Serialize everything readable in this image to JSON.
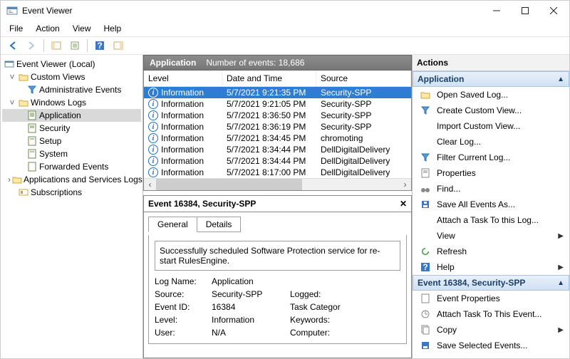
{
  "title": "Event Viewer",
  "menu": [
    "File",
    "Action",
    "View",
    "Help"
  ],
  "tree": {
    "root": "Event Viewer (Local)",
    "custom": "Custom Views",
    "admin": "Administrative Events",
    "winlogs": "Windows Logs",
    "app": "Application",
    "sec": "Security",
    "setup": "Setup",
    "sys": "System",
    "fwd": "Forwarded Events",
    "apps_svc": "Applications and Services Logs",
    "subs": "Subscriptions"
  },
  "grid": {
    "header": "Application",
    "count_label": "Number of events: 18,686",
    "col_level": "Level",
    "col_date": "Date and Time",
    "col_source": "Source",
    "rows": [
      {
        "level": "Information",
        "dt": "5/7/2021 9:21:35 PM",
        "src": "Security-SPP"
      },
      {
        "level": "Information",
        "dt": "5/7/2021 9:21:05 PM",
        "src": "Security-SPP"
      },
      {
        "level": "Information",
        "dt": "5/7/2021 8:36:50 PM",
        "src": "Security-SPP"
      },
      {
        "level": "Information",
        "dt": "5/7/2021 8:36:19 PM",
        "src": "Security-SPP"
      },
      {
        "level": "Information",
        "dt": "5/7/2021 8:34:45 PM",
        "src": "chromoting"
      },
      {
        "level": "Information",
        "dt": "5/7/2021 8:34:44 PM",
        "src": "DellDigitalDelivery"
      },
      {
        "level": "Information",
        "dt": "5/7/2021 8:34:44 PM",
        "src": "DellDigitalDelivery"
      },
      {
        "level": "Information",
        "dt": "5/7/2021 8:17:00 PM",
        "src": "DellDigitalDelivery"
      }
    ]
  },
  "detail": {
    "title": "Event 16384, Security-SPP",
    "tab_general": "General",
    "tab_details": "Details",
    "message": "Successfully scheduled Software Protection service for re-start RulesEngine.",
    "lbl_logname": "Log Name:",
    "val_logname": "Application",
    "lbl_source": "Source:",
    "val_source": "Security-SPP",
    "lbl_eventid": "Event ID:",
    "val_eventid": "16384",
    "lbl_level": "Level:",
    "val_level": "Information",
    "lbl_user": "User:",
    "val_user": "N/A",
    "lbl_logged": "Logged:",
    "lbl_taskcat": "Task Categor",
    "lbl_keywords": "Keywords:",
    "lbl_computer": "Computer:"
  },
  "actions": {
    "header": "Actions",
    "sec_app": "Application",
    "sec_evt": "Event 16384, Security-SPP",
    "open_saved": "Open Saved Log...",
    "create_custom": "Create Custom View...",
    "import_custom": "Import Custom View...",
    "clear_log": "Clear Log...",
    "filter_log": "Filter Current Log...",
    "properties": "Properties",
    "find": "Find...",
    "save_all": "Save All Events As...",
    "attach_log": "Attach a Task To this Log...",
    "view": "View",
    "refresh": "Refresh",
    "help": "Help",
    "evt_props": "Event Properties",
    "attach_evt": "Attach Task To This Event...",
    "copy": "Copy",
    "save_sel": "Save Selected Events..."
  }
}
